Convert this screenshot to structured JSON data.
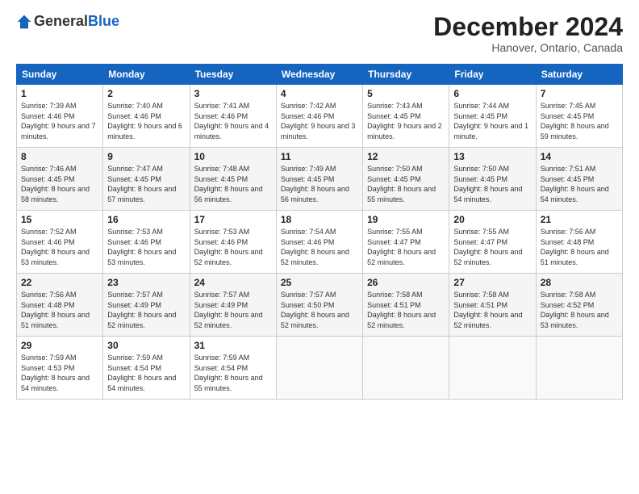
{
  "header": {
    "logo": {
      "general": "General",
      "blue": "Blue"
    },
    "title": "December 2024",
    "location": "Hanover, Ontario, Canada"
  },
  "calendar": {
    "days_of_week": [
      "Sunday",
      "Monday",
      "Tuesday",
      "Wednesday",
      "Thursday",
      "Friday",
      "Saturday"
    ],
    "weeks": [
      [
        {
          "day": "1",
          "sunrise": "7:39 AM",
          "sunset": "4:46 PM",
          "daylight": "9 hours and 7 minutes."
        },
        {
          "day": "2",
          "sunrise": "7:40 AM",
          "sunset": "4:46 PM",
          "daylight": "9 hours and 6 minutes."
        },
        {
          "day": "3",
          "sunrise": "7:41 AM",
          "sunset": "4:46 PM",
          "daylight": "9 hours and 4 minutes."
        },
        {
          "day": "4",
          "sunrise": "7:42 AM",
          "sunset": "4:46 PM",
          "daylight": "9 hours and 3 minutes."
        },
        {
          "day": "5",
          "sunrise": "7:43 AM",
          "sunset": "4:45 PM",
          "daylight": "9 hours and 2 minutes."
        },
        {
          "day": "6",
          "sunrise": "7:44 AM",
          "sunset": "4:45 PM",
          "daylight": "9 hours and 1 minute."
        },
        {
          "day": "7",
          "sunrise": "7:45 AM",
          "sunset": "4:45 PM",
          "daylight": "8 hours and 59 minutes."
        }
      ],
      [
        {
          "day": "8",
          "sunrise": "7:46 AM",
          "sunset": "4:45 PM",
          "daylight": "8 hours and 58 minutes."
        },
        {
          "day": "9",
          "sunrise": "7:47 AM",
          "sunset": "4:45 PM",
          "daylight": "8 hours and 57 minutes."
        },
        {
          "day": "10",
          "sunrise": "7:48 AM",
          "sunset": "4:45 PM",
          "daylight": "8 hours and 56 minutes."
        },
        {
          "day": "11",
          "sunrise": "7:49 AM",
          "sunset": "4:45 PM",
          "daylight": "8 hours and 56 minutes."
        },
        {
          "day": "12",
          "sunrise": "7:50 AM",
          "sunset": "4:45 PM",
          "daylight": "8 hours and 55 minutes."
        },
        {
          "day": "13",
          "sunrise": "7:50 AM",
          "sunset": "4:45 PM",
          "daylight": "8 hours and 54 minutes."
        },
        {
          "day": "14",
          "sunrise": "7:51 AM",
          "sunset": "4:45 PM",
          "daylight": "8 hours and 54 minutes."
        }
      ],
      [
        {
          "day": "15",
          "sunrise": "7:52 AM",
          "sunset": "4:46 PM",
          "daylight": "8 hours and 53 minutes."
        },
        {
          "day": "16",
          "sunrise": "7:53 AM",
          "sunset": "4:46 PM",
          "daylight": "8 hours and 53 minutes."
        },
        {
          "day": "17",
          "sunrise": "7:53 AM",
          "sunset": "4:46 PM",
          "daylight": "8 hours and 52 minutes."
        },
        {
          "day": "18",
          "sunrise": "7:54 AM",
          "sunset": "4:46 PM",
          "daylight": "8 hours and 52 minutes."
        },
        {
          "day": "19",
          "sunrise": "7:55 AM",
          "sunset": "4:47 PM",
          "daylight": "8 hours and 52 minutes."
        },
        {
          "day": "20",
          "sunrise": "7:55 AM",
          "sunset": "4:47 PM",
          "daylight": "8 hours and 52 minutes."
        },
        {
          "day": "21",
          "sunrise": "7:56 AM",
          "sunset": "4:48 PM",
          "daylight": "8 hours and 51 minutes."
        }
      ],
      [
        {
          "day": "22",
          "sunrise": "7:56 AM",
          "sunset": "4:48 PM",
          "daylight": "8 hours and 51 minutes."
        },
        {
          "day": "23",
          "sunrise": "7:57 AM",
          "sunset": "4:49 PM",
          "daylight": "8 hours and 52 minutes."
        },
        {
          "day": "24",
          "sunrise": "7:57 AM",
          "sunset": "4:49 PM",
          "daylight": "8 hours and 52 minutes."
        },
        {
          "day": "25",
          "sunrise": "7:57 AM",
          "sunset": "4:50 PM",
          "daylight": "8 hours and 52 minutes."
        },
        {
          "day": "26",
          "sunrise": "7:58 AM",
          "sunset": "4:51 PM",
          "daylight": "8 hours and 52 minutes."
        },
        {
          "day": "27",
          "sunrise": "7:58 AM",
          "sunset": "4:51 PM",
          "daylight": "8 hours and 52 minutes."
        },
        {
          "day": "28",
          "sunrise": "7:58 AM",
          "sunset": "4:52 PM",
          "daylight": "8 hours and 53 minutes."
        }
      ],
      [
        {
          "day": "29",
          "sunrise": "7:59 AM",
          "sunset": "4:53 PM",
          "daylight": "8 hours and 54 minutes."
        },
        {
          "day": "30",
          "sunrise": "7:59 AM",
          "sunset": "4:54 PM",
          "daylight": "8 hours and 54 minutes."
        },
        {
          "day": "31",
          "sunrise": "7:59 AM",
          "sunset": "4:54 PM",
          "daylight": "8 hours and 55 minutes."
        },
        null,
        null,
        null,
        null
      ]
    ]
  }
}
